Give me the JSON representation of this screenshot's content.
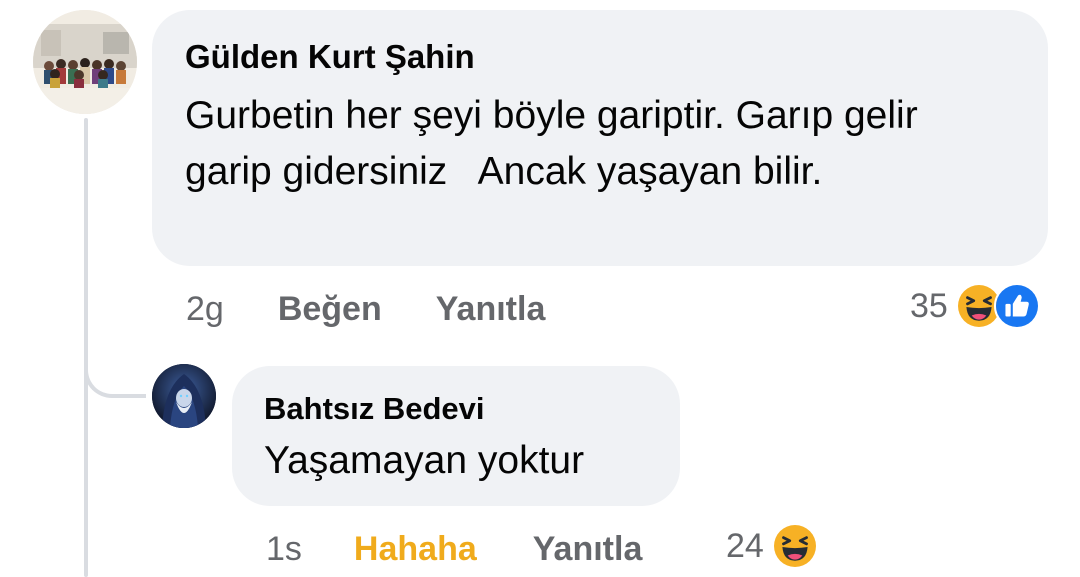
{
  "comments": [
    {
      "author": "Gülden Kurt Şahin",
      "text": "Gurbetin her şeyi böyle gariptir. Garıp gelir garip gidersiniz   Ancak yaşayan bilir.",
      "time": "2g",
      "like_label": "Beğen",
      "reply_label": "Yanıtla",
      "reaction_count": "35",
      "reactions": [
        "haha-icon",
        "like-icon"
      ]
    }
  ],
  "replies": [
    {
      "author": "Bahtsız Bedevi",
      "text": "Yaşamayan yoktur",
      "time": "1s",
      "like_label": "Hahaha",
      "reply_label": "Yanıtla",
      "reaction_count": "24",
      "reactions": [
        "haha-icon"
      ],
      "user_reaction": "haha"
    }
  ],
  "colors": {
    "bubble": "#f0f2f5",
    "secondary_text": "#65676b",
    "haha_yellow": "#f0ab1c",
    "like_blue": "#1877f2"
  }
}
